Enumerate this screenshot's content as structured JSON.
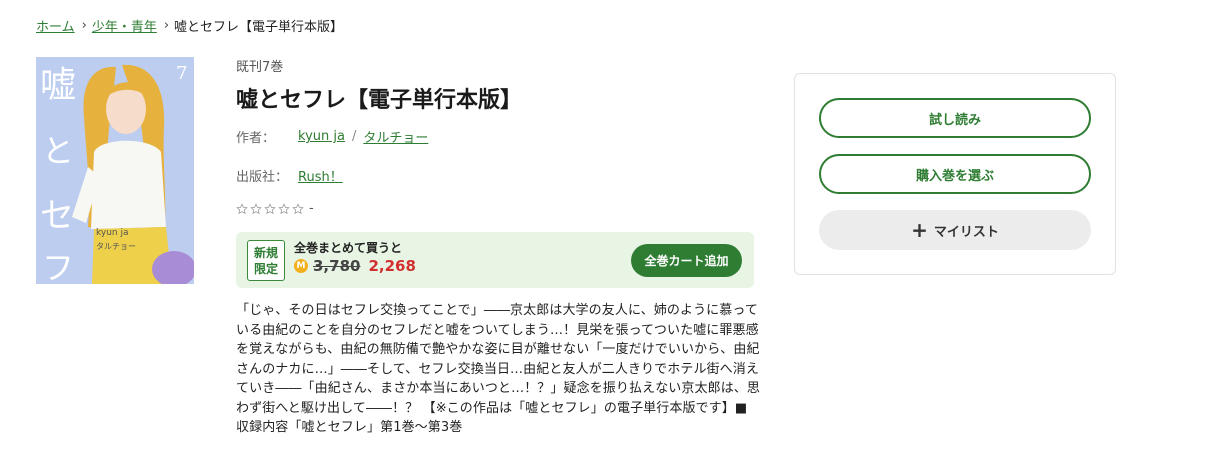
{
  "breadcrumb": {
    "items": [
      "ホーム",
      "少年・青年"
    ],
    "current": "嘘とセフレ【電子単行本版】"
  },
  "cover": {
    "title_text": "嘘とセフレ",
    "volume_number": "7",
    "author_text": "kyun ja",
    "artist_text": "タルチョー"
  },
  "book": {
    "volume_count": "既刊7巻",
    "title": "嘘とセフレ【電子単行本版】",
    "author_label": "作者：",
    "authors": [
      "kyun ja",
      "タルチョー"
    ],
    "author_separator": "/",
    "publisher_label": "出版社：",
    "publisher": "Rush！",
    "rating_text": "-",
    "rating_stars": 0
  },
  "buy_all": {
    "badge_line1": "新規",
    "badge_line2": "限定",
    "label": "全巻まとめて買うと",
    "coin_icon": "M",
    "old_price": "3,780",
    "new_price": "2,268",
    "button_label": "全巻カート追加"
  },
  "description": "「じゃ、その日はセフレ交換ってことで」――京太郎は大学の友人に、姉のように慕っている由紀のことを自分のセフレだと嘘をついてしまう…！見栄を張ってついた嘘に罪悪感を覚えながらも、由紀の無防備で艶やかな姿に目が離せない「一度だけでいいから、由紀さんのナカに…」――そして、セフレ交換当日…由紀と友人が二人きりでホテル街へ消えていき――「由紀さん、まさか本当にあいつと…！？」疑念を振り払えない京太郎は、思わず街へと駆け出して――！？ 【※この作品は「嘘とセフレ」の電子単行本版です】■収録内容「嘘とセフレ」第1巻～第3巻",
  "sidebar": {
    "trial_label": "試し読み",
    "select_label": "購入巻を選ぶ",
    "mylist_label": "マイリスト"
  },
  "colors": {
    "accent": "#2e7d32",
    "price": "#d32f2f",
    "buyall_bg": "#e8f5e5",
    "coin": "#f2b01e"
  }
}
